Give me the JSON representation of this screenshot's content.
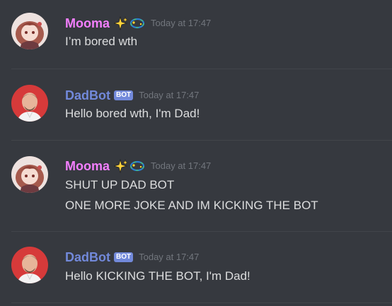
{
  "channel": {
    "messages": [
      {
        "author": "Mooma",
        "author_color": "#f47fff",
        "badges": [
          "sparkles-icon",
          "dizzy-ring-icon"
        ],
        "bot_tag": "",
        "timestamp": "Today at 17:47",
        "lines": [
          "I’m bored wth"
        ]
      },
      {
        "author": "DadBot",
        "author_color": "#7289da",
        "badges": [],
        "bot_tag": "BOT",
        "timestamp": "Today at 17:47",
        "lines": [
          "Hello bored wth, I'm Dad!"
        ]
      },
      {
        "author": "Mooma",
        "author_color": "#f47fff",
        "badges": [
          "sparkles-icon",
          "dizzy-ring-icon"
        ],
        "bot_tag": "",
        "timestamp": "Today at 17:47",
        "lines": [
          "SHUT UP DAD BOT",
          "ONE MORE JOKE AND IM KICKING THE BOT"
        ]
      },
      {
        "author": "DadBot",
        "author_color": "#7289da",
        "badges": [],
        "bot_tag": "BOT",
        "timestamp": "Today at 17:47",
        "lines": [
          "Hello KICKING THE BOT, I'm Dad!"
        ]
      }
    ]
  },
  "colors": {
    "background": "#36393f",
    "text": "#dcddde",
    "timestamp": "#72767d",
    "separator": "#42454a",
    "bot_tag": "#7289da"
  }
}
